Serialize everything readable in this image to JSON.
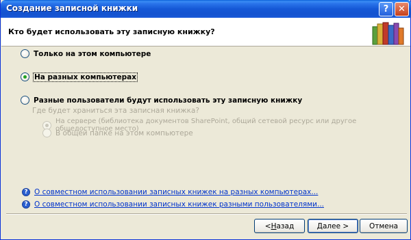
{
  "window": {
    "title": "Создание записной книжки",
    "help_button": "?",
    "close_button": "✕"
  },
  "header": {
    "question": "Кто будет использовать эту записную книжку?"
  },
  "options": {
    "only_this_computer": "Только на этом компьютере",
    "different_computers": "На разных компьютерах",
    "different_users": "Разные пользователи будут использовать эту записную книжку",
    "storage_question": "Где будет храниться эта записная книжка?",
    "on_server": "На сервере (библиотека документов SharePoint, общий сетевой ресурс или другое общедоступное место)",
    "shared_folder": "В общей папке на этом компьютере",
    "selected": "different_computers"
  },
  "links": {
    "sharing_computers": "О совместном использовании записных книжек на разных компьютерах...",
    "sharing_users": "О совместном использовании записных книжек разными пользователями..."
  },
  "buttons": {
    "back_prefix": "< ",
    "back_hotkey": "Н",
    "back_rest": "азад",
    "next_hotkey": "Д",
    "next_rest": "алее >",
    "cancel": "Отмена"
  },
  "colors": {
    "titlebar": "#1558d6",
    "link": "#0033cc",
    "radio_dot": "#21a121"
  }
}
